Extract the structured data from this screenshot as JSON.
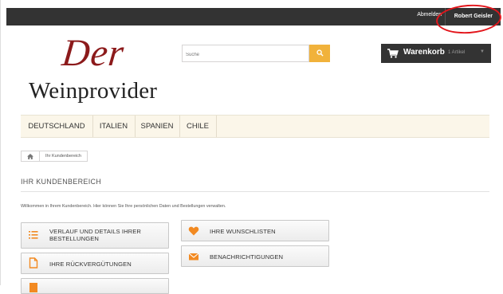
{
  "topbar": {
    "logout_label": "Abmelden",
    "username": "Robert Geisler"
  },
  "logo": {
    "line1": "Der",
    "line2": "Weinprovider"
  },
  "search": {
    "placeholder": "Suche",
    "button_icon": "search-icon"
  },
  "cart": {
    "label": "Warenkorb",
    "count_text": "1 Artikel",
    "icon": "cart-icon"
  },
  "nav": {
    "items": [
      {
        "label": "DEUTSCHLAND"
      },
      {
        "label": "ITALIEN"
      },
      {
        "label": "SPANIEN"
      },
      {
        "label": "CHILE"
      }
    ]
  },
  "breadcrumb": {
    "home_icon": "home-icon",
    "current": "Ihr Kundenbereich"
  },
  "page": {
    "heading": "IHR KUNDENBEREICH",
    "intro": "Willkommen in Ihrem Kundenbereich. Hier können Sie Ihre persönlichen Daten und Bestellungen verwalten."
  },
  "account_links": [
    {
      "label_line1": "VERLAUF UND DETAILS IHRER",
      "label_line2": "BESTELLUNGEN",
      "icon": "list-icon"
    },
    {
      "label_line1": "IHRE RÜCKVERGÜTUNGEN",
      "icon": "document-icon"
    },
    {
      "label_line1": "IHRE WUNSCHLISTEN",
      "icon": "heart-icon"
    },
    {
      "label_line1": "BENACHRICHTIGUNGEN",
      "icon": "envelope-icon"
    }
  ],
  "colors": {
    "accent": "#f1b23b",
    "dark": "#333333",
    "icon_orange": "#f28a22",
    "logo_red": "#8c1a1b",
    "nav_bg": "#fbf6e9",
    "annotation_red": "#e3151b"
  }
}
